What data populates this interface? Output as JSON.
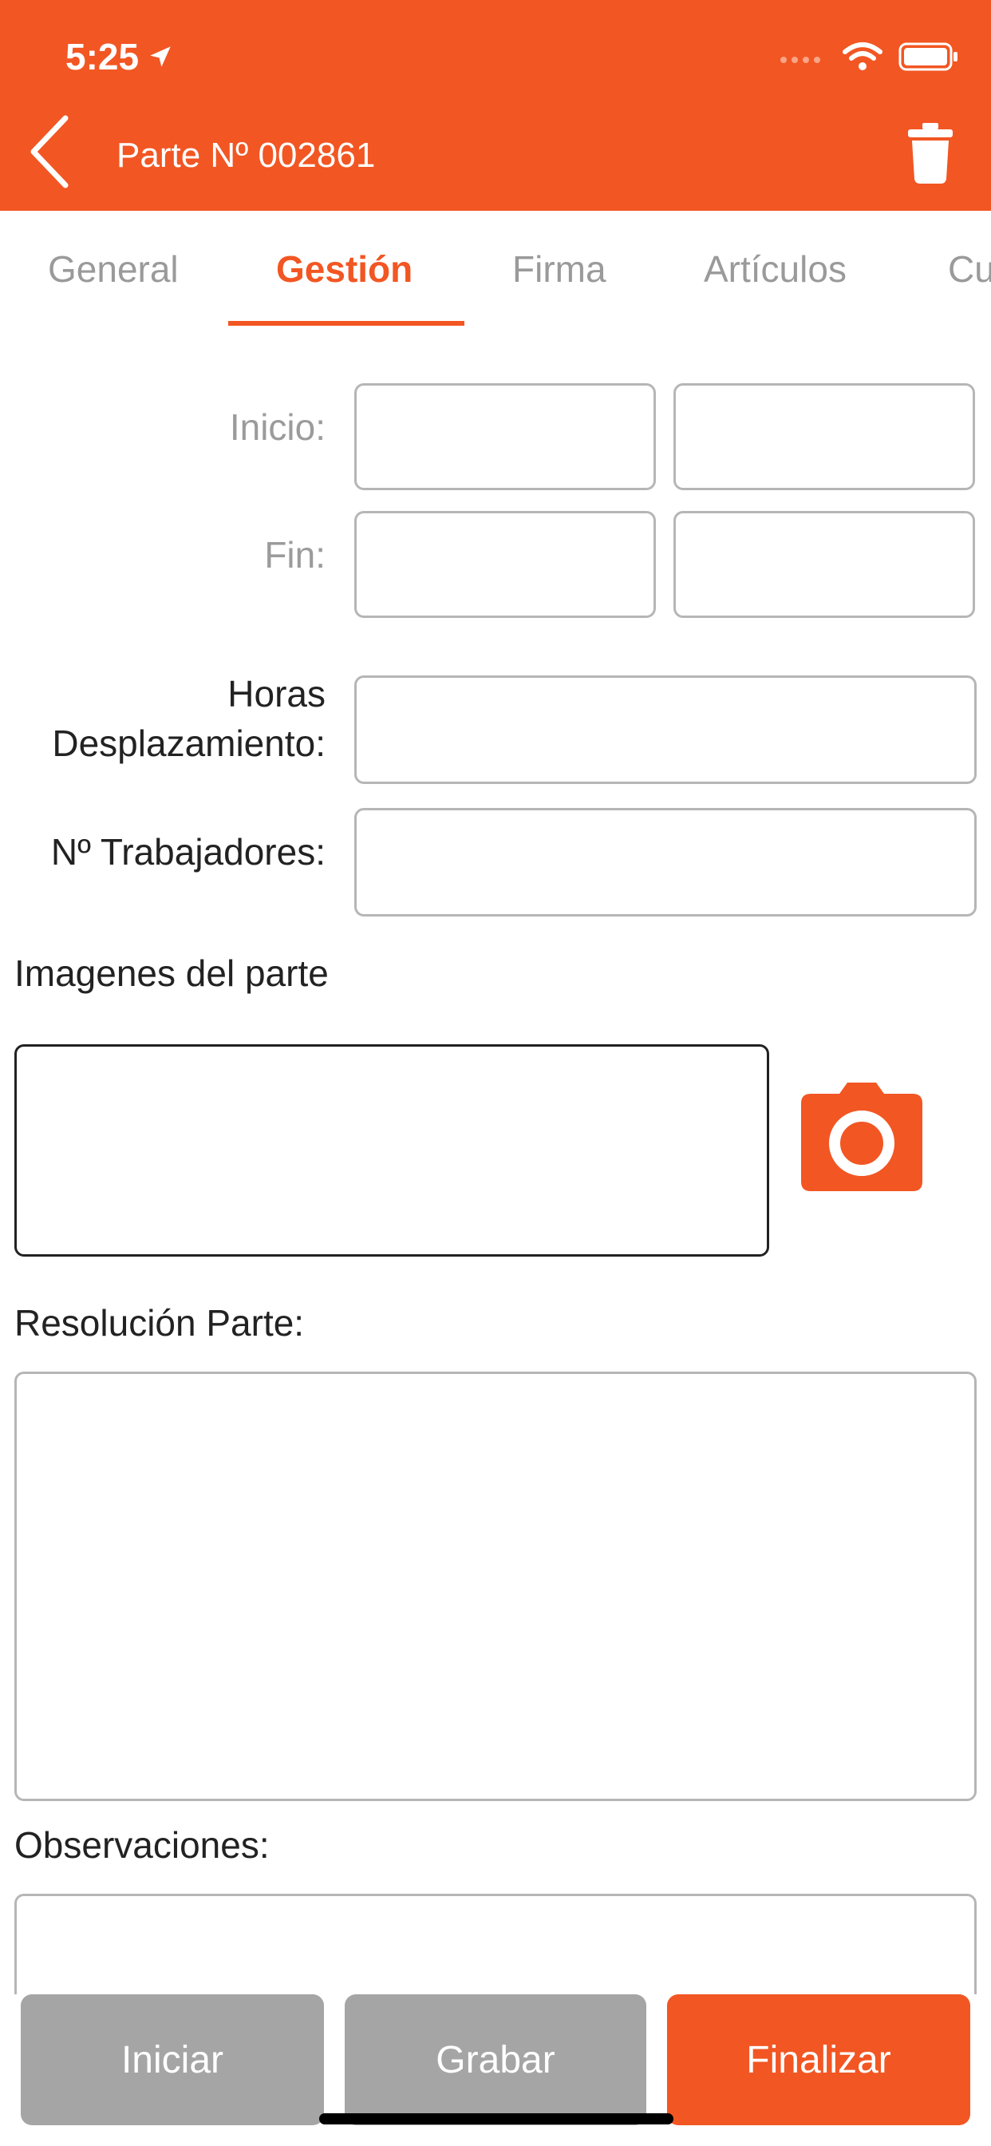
{
  "status_bar": {
    "time": "5:25"
  },
  "header": {
    "title": "Parte Nº 002861"
  },
  "tabs": [
    {
      "label": "General"
    },
    {
      "label": "Gestión",
      "active": true
    },
    {
      "label": "Firma"
    },
    {
      "label": "Artículos"
    },
    {
      "label": "Cu"
    }
  ],
  "form": {
    "inicio_label": "Inicio:",
    "fin_label": "Fin:",
    "horas_label_line1": "Horas",
    "horas_label_line2": "Desplazamiento:",
    "trabajadores_label": "Nº Trabajadores:",
    "imagenes_label": "Imagenes del parte",
    "resolucion_label": "Resolución Parte:",
    "observaciones_label": "Observaciones:"
  },
  "footer": {
    "iniciar": "Iniciar",
    "grabar": "Grabar",
    "finalizar": "Finalizar"
  },
  "colors": {
    "accent": "#F25623",
    "gray_button": "#A5A5A5"
  }
}
